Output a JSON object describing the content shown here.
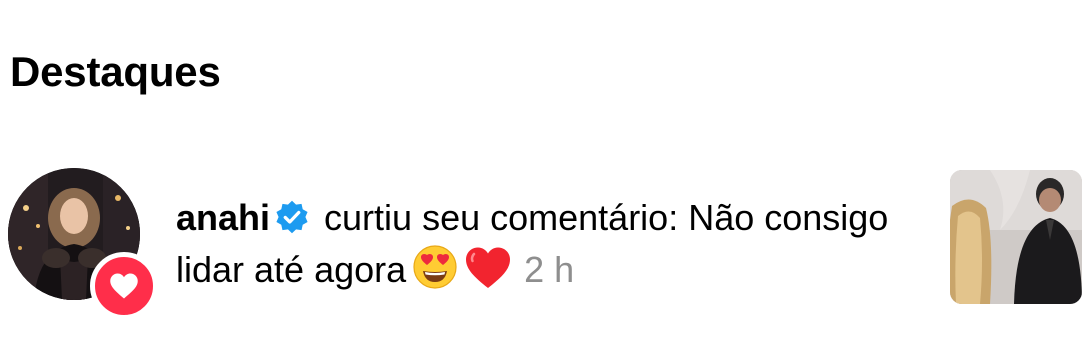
{
  "section": {
    "title": "Destaques"
  },
  "notification": {
    "username": "anahi",
    "verified_icon": "verified-badge-icon",
    "action_text": "curtiu seu comentário: Não consigo lidar até agora",
    "emojis": [
      "heart-eyes-emoji",
      "red-heart-emoji"
    ],
    "time": "2 h",
    "badge_icon": "heart-icon",
    "colors": {
      "verified": "#1d9bf0",
      "like_badge": "#ff2e4a",
      "timestamp": "#8e8e8e"
    }
  }
}
